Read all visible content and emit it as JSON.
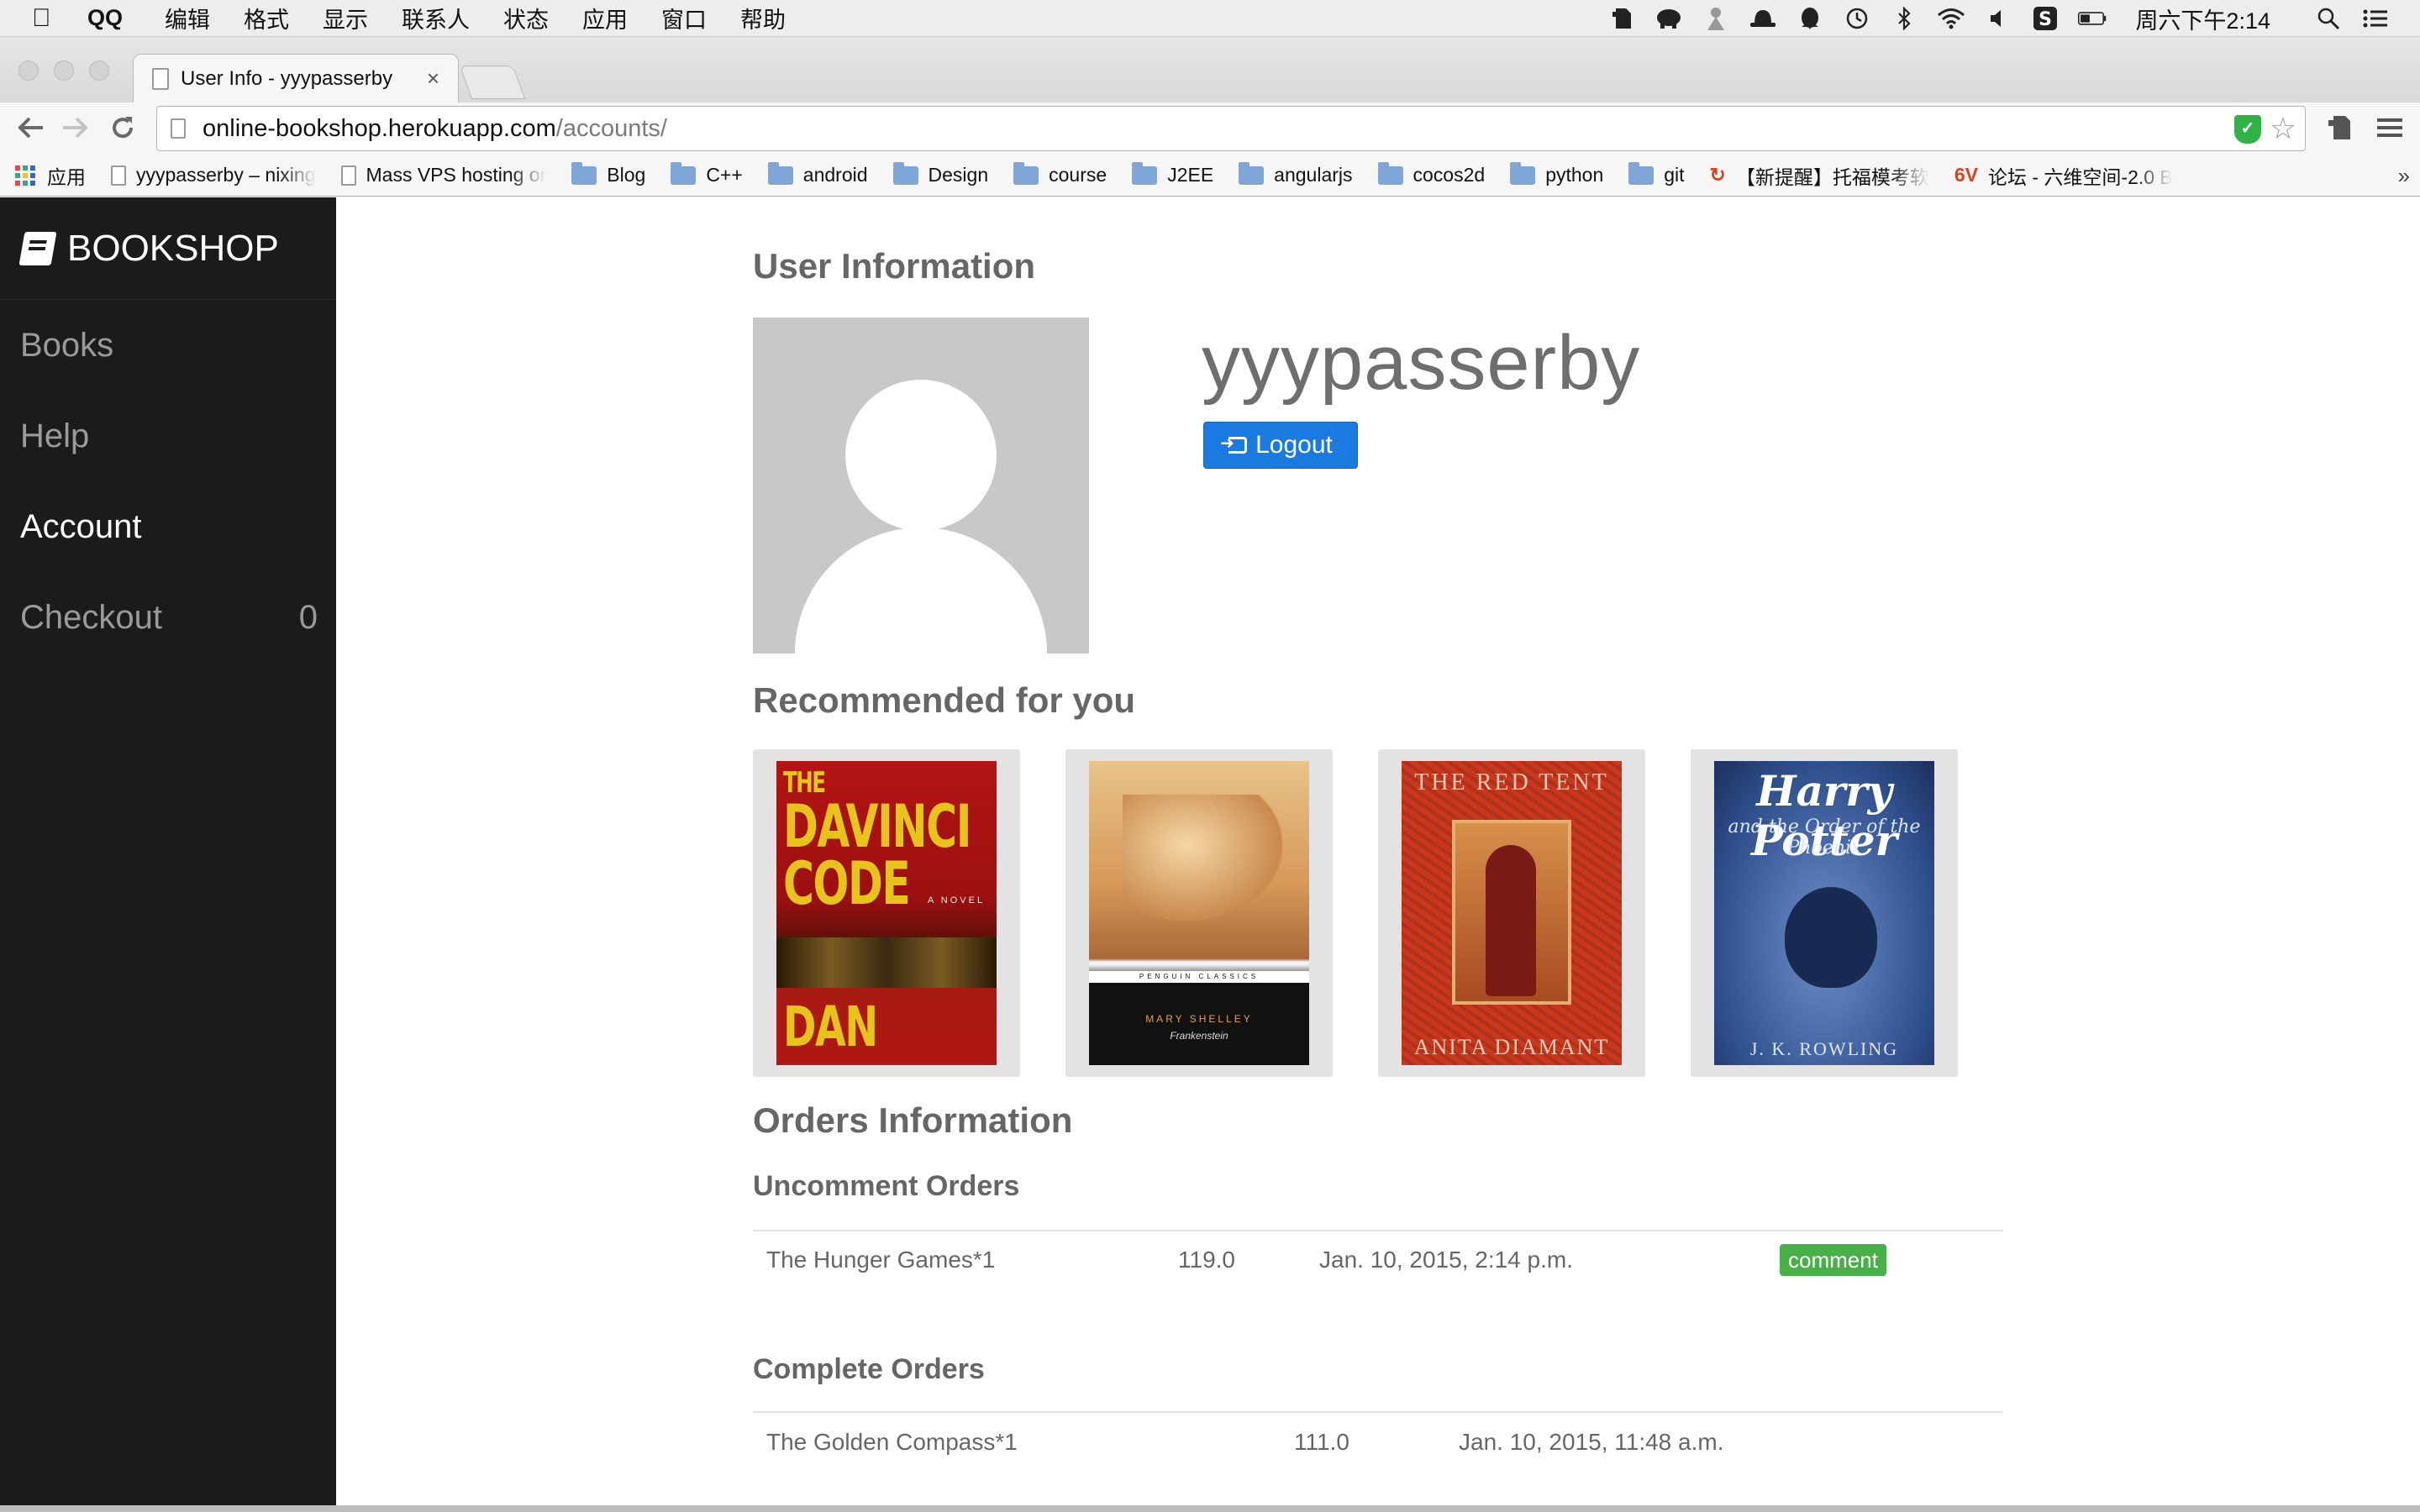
{
  "menubar": {
    "app_name": "QQ",
    "items": [
      "编辑",
      "格式",
      "显示",
      "联系人",
      "状态",
      "应用",
      "窗口",
      "帮助"
    ],
    "clock": "周六下午2:14",
    "status_icons": [
      "evernote-icon",
      "elephant-icon",
      "figure-icon",
      "bowler-hat-icon",
      "qq-penguin-icon",
      "time-machine-icon",
      "bluetooth-icon",
      "wifi-icon",
      "volume-icon",
      "s-app-icon",
      "battery-icon",
      "spotlight-icon",
      "notification-center-icon"
    ]
  },
  "browser": {
    "tab_title": "User Info - yyypasserby",
    "tab_close": "×",
    "url_host": "online-bookshop.herokuapp.com",
    "url_path": "/accounts/",
    "bookmarks": [
      {
        "label": "应用",
        "kind": "apps"
      },
      {
        "label": "yyypasserby – nixing",
        "kind": "doc"
      },
      {
        "label": "Mass VPS hosting or",
        "kind": "doc"
      },
      {
        "label": "Blog",
        "kind": "folder"
      },
      {
        "label": "C++",
        "kind": "folder"
      },
      {
        "label": "android",
        "kind": "folder"
      },
      {
        "label": "Design",
        "kind": "folder"
      },
      {
        "label": "course",
        "kind": "folder"
      },
      {
        "label": "J2EE",
        "kind": "folder"
      },
      {
        "label": "angularjs",
        "kind": "folder"
      },
      {
        "label": "cocos2d",
        "kind": "folder"
      },
      {
        "label": "python",
        "kind": "folder"
      },
      {
        "label": "git",
        "kind": "folder"
      },
      {
        "label": "【新提醒】托福模考软",
        "kind": "red"
      },
      {
        "label": "论坛 - 六维空间-2.0 B",
        "kind": "6v"
      }
    ],
    "bookmarks_more": "»"
  },
  "sidebar": {
    "brand": "BOOKSHOP",
    "items": [
      {
        "label": "Books",
        "badge": ""
      },
      {
        "label": "Help",
        "badge": ""
      },
      {
        "label": "Account",
        "badge": ""
      },
      {
        "label": "Checkout",
        "badge": "0"
      }
    ],
    "active": "Account"
  },
  "main": {
    "user_info_heading": "User Information",
    "username": "yyypasserby",
    "logout_label": "Logout",
    "recommended_heading": "Recommended for you",
    "books": [
      {
        "cover_lines": [
          "THE",
          "DAVINCI",
          "CODE"
        ],
        "tag": "A NOVEL",
        "author": "DAN BROWN"
      },
      {
        "author": "MARY SHELLEY",
        "title": "Frankenstein",
        "imprint": "PENGUIN CLASSICS"
      },
      {
        "title": "THE RED TENT",
        "author": "ANITA DIAMANT"
      },
      {
        "title": "Harry Potter",
        "subtitle": "and the Order of the Phoenix",
        "author": "J. K. ROWLING"
      }
    ],
    "orders_heading": "Orders Information",
    "uncomment_heading": "Uncomment Orders",
    "uncomment_orders": [
      {
        "item": "The Hunger Games*1",
        "price": "119.0",
        "date": "Jan. 10, 2015, 2:14 p.m.",
        "action": "comment"
      }
    ],
    "complete_heading": "Complete Orders",
    "complete_orders": [
      {
        "item": "The Golden Compass*1",
        "price": "111.0",
        "date": "Jan. 10, 2015, 11:48 a.m."
      }
    ]
  }
}
